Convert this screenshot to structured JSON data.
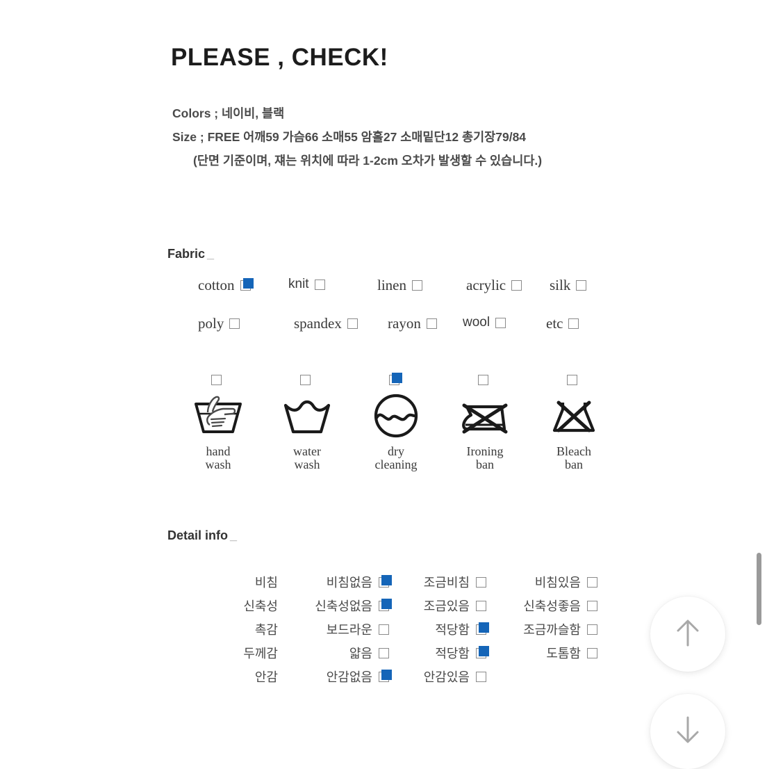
{
  "page": {
    "background": "#ffffff",
    "accent_color": "#1565b8",
    "text_color": "#4a4a4a"
  },
  "header": {
    "title": "PLEASE , CHECK!",
    "colors_line": "Colors ; 네이비, 블랙",
    "size_line": "Size ;  FREE 어깨59 가슴66 소매55 암홀27 소매밑단12 총기장79/84",
    "note_line": "(단면 기준이며, 쟤는 위치에 따라 1-2cm 오차가 발생할 수 있습니다.)"
  },
  "fabric": {
    "heading": "Fabric",
    "heading_suffix": "_",
    "rows": [
      [
        {
          "label": "cotton",
          "checked": true,
          "font": "serif"
        },
        {
          "label": "knit",
          "checked": false,
          "font": "sans"
        },
        {
          "label": "linen",
          "checked": false,
          "font": "serif"
        },
        {
          "label": "acrylic",
          "checked": false,
          "font": "serif"
        },
        {
          "label": "silk",
          "checked": false,
          "font": "serif"
        }
      ],
      [
        {
          "label": "poly",
          "checked": false,
          "font": "serif"
        },
        {
          "label": "spandex",
          "checked": false,
          "font": "serif"
        },
        {
          "label": "rayon",
          "checked": false,
          "font": "serif"
        },
        {
          "label": "wool",
          "checked": false,
          "font": "sans"
        },
        {
          "label": "etc",
          "checked": false,
          "font": "serif"
        }
      ]
    ]
  },
  "care": {
    "items": [
      {
        "icon": "hand-wash-icon",
        "label_line1": "hand",
        "label_line2": "wash",
        "checked": false
      },
      {
        "icon": "water-wash-icon",
        "label_line1": "water",
        "label_line2": "wash",
        "checked": false
      },
      {
        "icon": "dry-cleaning-icon",
        "label_line1": "dry",
        "label_line2": "cleaning",
        "checked": true
      },
      {
        "icon": "ironing-ban-icon",
        "label_line1": "Ironing",
        "label_line2": "ban",
        "checked": false
      },
      {
        "icon": "bleach-ban-icon",
        "label_line1": "Bleach",
        "label_line2": "ban",
        "checked": false
      }
    ]
  },
  "detail": {
    "heading": "Detail info",
    "heading_suffix": "_",
    "rows": [
      {
        "category": "비침",
        "options": [
          {
            "label": "비침없음",
            "checked": true
          },
          {
            "label": "조금비침",
            "checked": false
          },
          {
            "label": "비침있음",
            "checked": false
          }
        ]
      },
      {
        "category": "신축성",
        "options": [
          {
            "label": "신축성없음",
            "checked": true
          },
          {
            "label": "조금있음",
            "checked": false
          },
          {
            "label": "신축성좋음",
            "checked": false
          }
        ]
      },
      {
        "category": "촉감",
        "options": [
          {
            "label": "보드라운",
            "checked": false
          },
          {
            "label": "적당함",
            "checked": true
          },
          {
            "label": "조금까슬함",
            "checked": false
          }
        ]
      },
      {
        "category": "두께감",
        "options": [
          {
            "label": "얇음",
            "checked": false
          },
          {
            "label": "적당함",
            "checked": true
          },
          {
            "label": "도톰함",
            "checked": false
          }
        ]
      },
      {
        "category": "안감",
        "options": [
          {
            "label": "안감없음",
            "checked": true
          },
          {
            "label": "안감있음",
            "checked": false
          }
        ]
      }
    ]
  },
  "controls": {
    "scroll_up": {
      "icon": "arrow-up-icon",
      "label": ""
    },
    "scroll_down": {
      "icon": "arrow-down-icon",
      "label": ""
    }
  }
}
